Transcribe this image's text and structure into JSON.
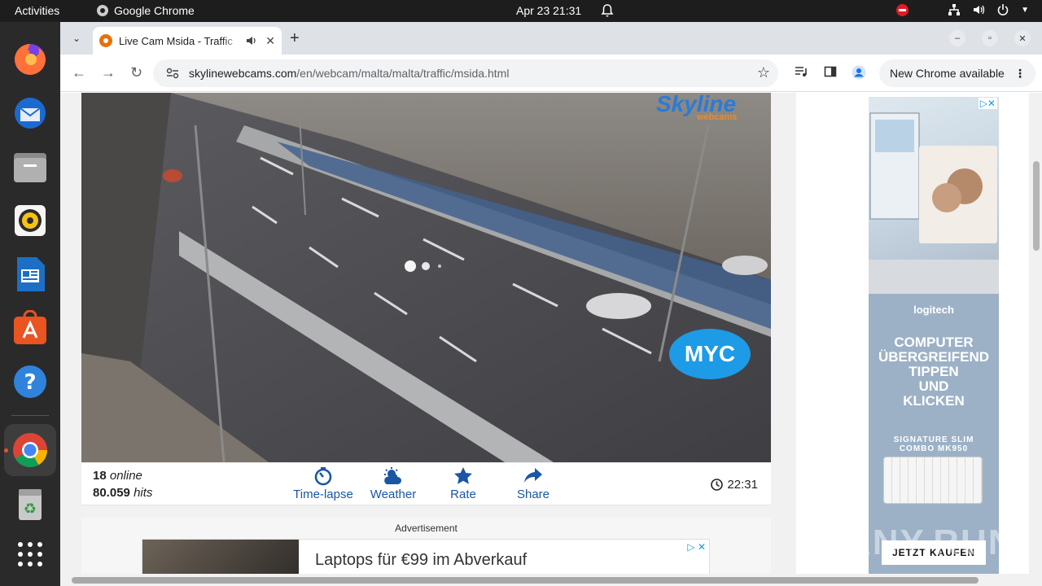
{
  "topbar": {
    "activities": "Activities",
    "app_name": "Google Chrome",
    "clock": "Apr 23  21:31"
  },
  "dock": {
    "items": [
      "firefox-icon",
      "thunderbird-icon",
      "files-icon",
      "rhythmbox-icon",
      "writer-icon",
      "app-center-icon",
      "help-icon",
      "chrome-icon",
      "trash-icon",
      "app-grid-icon"
    ]
  },
  "browser": {
    "tab_title": "Live Cam Msida - Traffic",
    "url_host": "skylinewebcams.com",
    "url_path": "/en/webcam/malta/malta/traffic/msida.html",
    "update_label": "New Chrome available"
  },
  "player": {
    "brand_top": "Skyline",
    "brand_bottom": "webcams",
    "sponsor": "MYC"
  },
  "stats": {
    "online_count": "18",
    "online_label": "online",
    "hits_count": "80.059",
    "hits_label": "hits",
    "actions": [
      "Time-lapse",
      "Weather",
      "Rate",
      "Share"
    ],
    "time": "22:31"
  },
  "ad_bottom": {
    "label": "Advertisement",
    "text": "Laptops für €99 im Abverkauf"
  },
  "ad_side": {
    "brand": "logitech",
    "headline": [
      "COMPUTER",
      "ÜBERGREIFEND",
      "TIPPEN",
      "UND",
      "KLICKEN"
    ],
    "product": [
      "SIGNATURE SLIM",
      "COMBO MK950"
    ],
    "cta": "JETZT KAUFEN"
  },
  "watermark": "ANY.RUN"
}
